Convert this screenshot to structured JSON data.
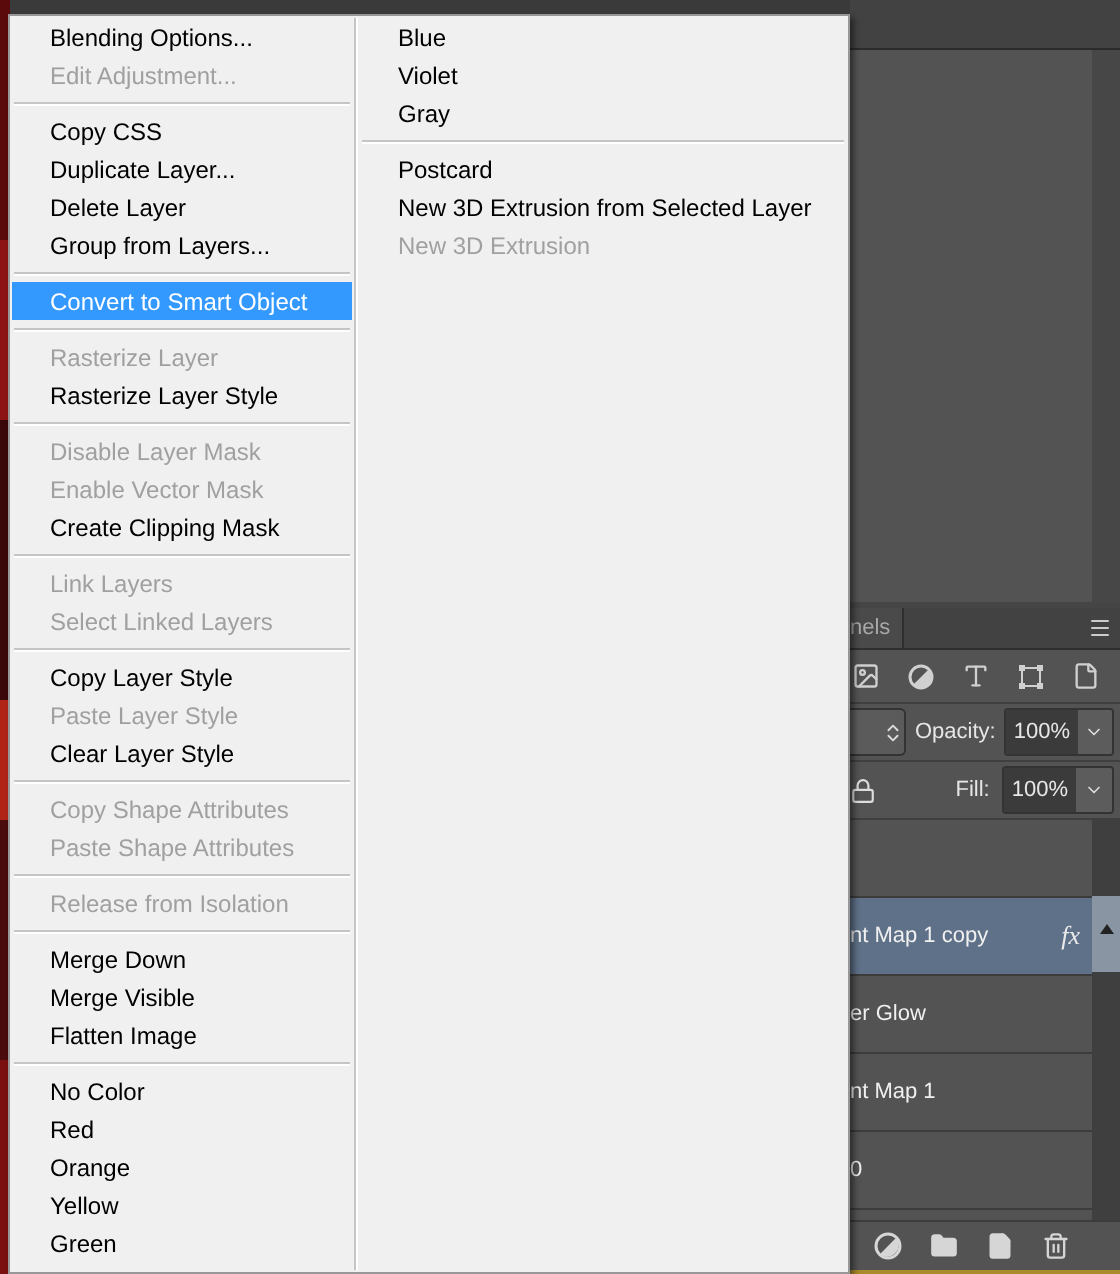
{
  "context_menu": {
    "left_groups": [
      [
        {
          "label": "Blending Options...",
          "disabled": false,
          "selected": false
        },
        {
          "label": "Edit Adjustment...",
          "disabled": true,
          "selected": false
        }
      ],
      [
        {
          "label": "Copy CSS",
          "disabled": false,
          "selected": false
        },
        {
          "label": "Duplicate Layer...",
          "disabled": false,
          "selected": false
        },
        {
          "label": "Delete Layer",
          "disabled": false,
          "selected": false
        },
        {
          "label": "Group from Layers...",
          "disabled": false,
          "selected": false
        }
      ],
      [
        {
          "label": "Convert to Smart Object",
          "disabled": false,
          "selected": true
        }
      ],
      [
        {
          "label": "Rasterize Layer",
          "disabled": true,
          "selected": false
        },
        {
          "label": "Rasterize Layer Style",
          "disabled": false,
          "selected": false
        }
      ],
      [
        {
          "label": "Disable Layer Mask",
          "disabled": true,
          "selected": false
        },
        {
          "label": "Enable Vector Mask",
          "disabled": true,
          "selected": false
        },
        {
          "label": "Create Clipping Mask",
          "disabled": false,
          "selected": false
        }
      ],
      [
        {
          "label": "Link Layers",
          "disabled": true,
          "selected": false
        },
        {
          "label": "Select Linked Layers",
          "disabled": true,
          "selected": false
        }
      ],
      [
        {
          "label": "Copy Layer Style",
          "disabled": false,
          "selected": false
        },
        {
          "label": "Paste Layer Style",
          "disabled": true,
          "selected": false
        },
        {
          "label": "Clear Layer Style",
          "disabled": false,
          "selected": false
        }
      ],
      [
        {
          "label": "Copy Shape Attributes",
          "disabled": true,
          "selected": false
        },
        {
          "label": "Paste Shape Attributes",
          "disabled": true,
          "selected": false
        }
      ],
      [
        {
          "label": "Release from Isolation",
          "disabled": true,
          "selected": false
        }
      ],
      [
        {
          "label": "Merge Down",
          "disabled": false,
          "selected": false
        },
        {
          "label": "Merge Visible",
          "disabled": false,
          "selected": false
        },
        {
          "label": "Flatten Image",
          "disabled": false,
          "selected": false
        }
      ],
      [
        {
          "label": "No Color",
          "disabled": false,
          "selected": false
        },
        {
          "label": "Red",
          "disabled": false,
          "selected": false
        },
        {
          "label": "Orange",
          "disabled": false,
          "selected": false
        },
        {
          "label": "Yellow",
          "disabled": false,
          "selected": false
        },
        {
          "label": "Green",
          "disabled": false,
          "selected": false
        }
      ]
    ],
    "right_groups": [
      [
        {
          "label": "Blue",
          "disabled": false,
          "selected": false
        },
        {
          "label": "Violet",
          "disabled": false,
          "selected": false
        },
        {
          "label": "Gray",
          "disabled": false,
          "selected": false
        }
      ],
      [
        {
          "label": "Postcard",
          "disabled": false,
          "selected": false
        },
        {
          "label": "New 3D Extrusion from Selected Layer",
          "disabled": false,
          "selected": false
        },
        {
          "label": "New 3D Extrusion",
          "disabled": true,
          "selected": false
        }
      ]
    ]
  },
  "layers_panel": {
    "tab": "nels",
    "opacity_label": "Opacity:",
    "opacity": "100%",
    "fill_label": "Fill:",
    "fill": "100%",
    "layers": [
      {
        "selected": false
      },
      {
        "name": "nt Map 1 copy",
        "selected": true,
        "fx_badge": "fx"
      },
      {
        "name": "er Glow",
        "selected": false
      },
      {
        "name": "nt Map 1",
        "selected": false
      },
      {
        "name": "0",
        "selected": false
      }
    ]
  }
}
